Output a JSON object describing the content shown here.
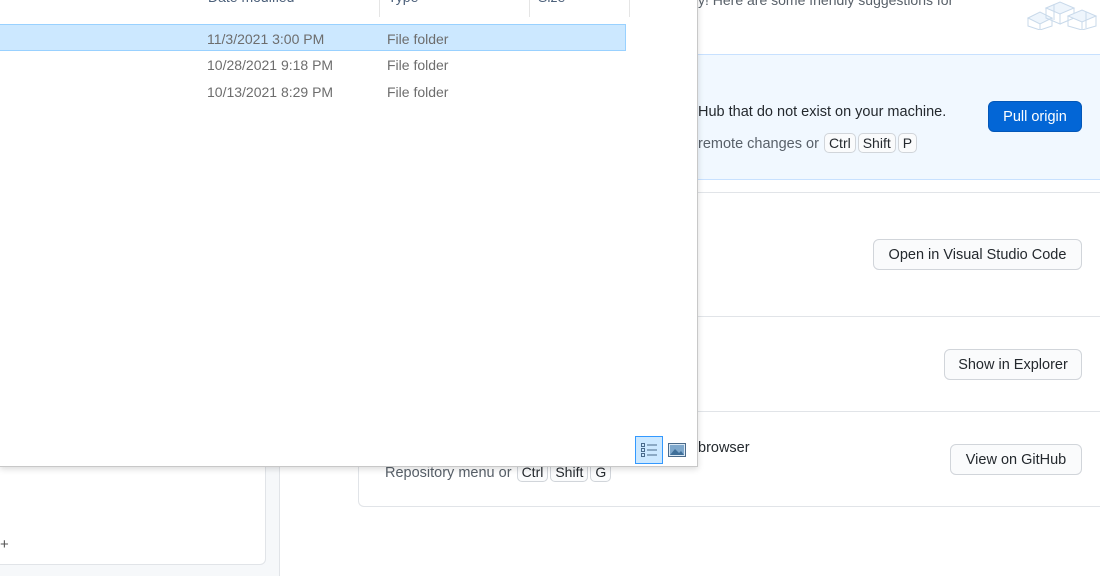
{
  "app": {
    "suggestions_fragment": "y! Here are some friendly suggestions for",
    "pull": {
      "description": "Hub that do not exist on your machine.",
      "hint_text": "remote changes or",
      "shortcut": [
        "Ctrl",
        "Shift",
        "P"
      ],
      "button_label": "Pull origin",
      "accent": "#0366d6"
    },
    "open_editor": {
      "button_label": "Open in Visual Studio Code"
    },
    "show_explorer": {
      "button_label": "Show in Explorer"
    },
    "view_github": {
      "title": "browser",
      "hint_text": "Repository menu or",
      "shortcut": [
        "Ctrl",
        "Shift",
        "G"
      ],
      "button_label": "View on GitHub"
    },
    "left_panel": {
      "plus_glyph": "+"
    }
  },
  "explorer": {
    "columns": [
      "Date modified",
      "Type",
      "Size"
    ],
    "rows": [
      {
        "date": "11/3/2021 3:00 PM",
        "type": "File folder",
        "selected": true
      },
      {
        "date": "10/28/2021 9:18 PM",
        "type": "File folder",
        "selected": false
      },
      {
        "date": "10/13/2021 8:29 PM",
        "type": "File folder",
        "selected": false
      }
    ],
    "view_buttons": [
      "details-view-icon",
      "tiles-view-icon"
    ],
    "selection_color": "#cce8ff"
  }
}
